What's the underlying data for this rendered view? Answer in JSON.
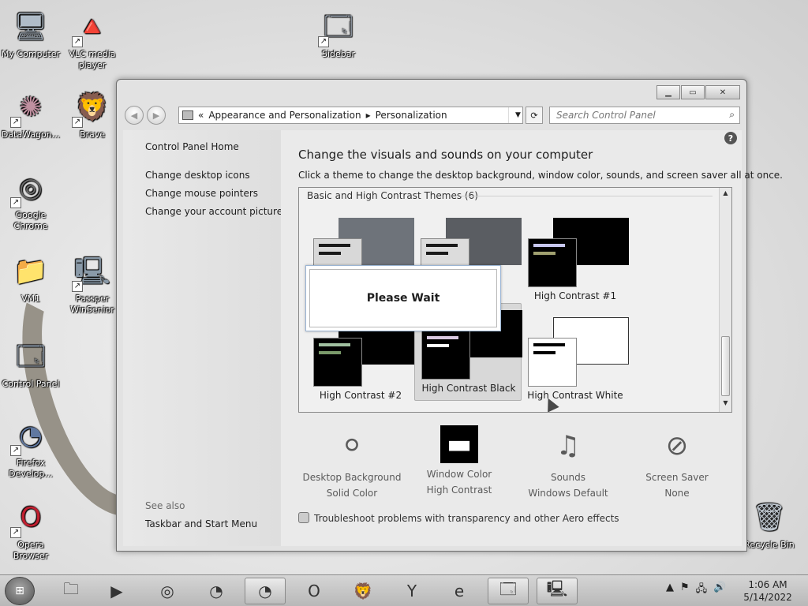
{
  "desktop": {
    "icons": [
      {
        "label": "My Computer",
        "name": "my-computer",
        "glyph": "🖥",
        "shortcut": false
      },
      {
        "label": "VLC media player",
        "name": "vlc",
        "glyph": "🔺",
        "shortcut": true
      },
      {
        "label": "Sidebar",
        "name": "sidebar",
        "glyph": "🗔",
        "shortcut": true
      },
      {
        "label": "DataWagon...",
        "name": "datawagon",
        "glyph": "✺",
        "shortcut": true
      },
      {
        "label": "Brave",
        "name": "brave",
        "glyph": "🦁",
        "shortcut": true
      },
      {
        "label": "Google Chrome",
        "name": "google-chrome",
        "glyph": "◎",
        "shortcut": true
      },
      {
        "label": "VM1",
        "name": "vm1",
        "glyph": "📁",
        "shortcut": false
      },
      {
        "label": "Passper WinSenior",
        "name": "passper-winsenior",
        "glyph": "🖳",
        "shortcut": true
      },
      {
        "label": "Control Panel",
        "name": "control-panel",
        "glyph": "🗔",
        "shortcut": false
      },
      {
        "label": "Firefox Develop...",
        "name": "firefox-developer",
        "glyph": "◔",
        "shortcut": true
      },
      {
        "label": "Opera Browser",
        "name": "opera",
        "glyph": "O",
        "shortcut": true
      },
      {
        "label": "Recycle Bin",
        "name": "recycle-bin",
        "glyph": "🗑",
        "shortcut": false
      }
    ]
  },
  "window": {
    "controls": {
      "minimize": "▁",
      "maximize": "▭",
      "close": "✕"
    },
    "nav": {
      "back": "◀",
      "forward": "▶"
    },
    "address": {
      "chevrons": "«",
      "separator": "▸",
      "crumb1": "Appearance and Personalization",
      "crumb2": "Personalization",
      "dropdown": "▼"
    },
    "refresh": "⟳",
    "search": {
      "placeholder": "Search Control Panel",
      "icon": "⌕"
    },
    "left": {
      "home": "Control Panel Home",
      "links": [
        "Change desktop icons",
        "Change mouse pointers",
        "Change your account picture"
      ],
      "see_also": "See also",
      "taskbar_link": "Taskbar and Start Menu"
    },
    "content": {
      "help": "?",
      "title": "Change the visuals and sounds on your computer",
      "description": "Click a theme to change the desktop background, window color, sounds, and screen saver all at once.",
      "group_header": "Basic and High Contrast Themes (6)",
      "themes": [
        {
          "label": "",
          "bg": "#6e737a",
          "win": "#d8d8d8",
          "bar1": "#1a1a1a",
          "bar2": "#1a1a1a"
        },
        {
          "label": "",
          "bg": "#5a5d62",
          "win": "#dcdcdc",
          "bar1": "#1a1a1a",
          "bar2": "#1a1a1a"
        },
        {
          "label": "High Contrast #1",
          "bg": "#000000",
          "win": "#000000",
          "bar1": "#c8c8f0",
          "bar2": "#a0a070"
        },
        {
          "label": "High Contrast #2",
          "bg": "#000000",
          "win": "#000000",
          "bar1": "#a0c0a0",
          "bar2": "#7a9a6a"
        },
        {
          "label": "High Contrast Black",
          "bg": "#000000",
          "win": "#000000",
          "bar1": "#d8c8e0",
          "bar2": "#ffffff"
        },
        {
          "label": "High Contrast White",
          "bg": "#ffffff",
          "win": "#ffffff",
          "bar1": "#000000",
          "bar2": "#000000"
        }
      ],
      "wait_text": "Please Wait",
      "bottom": [
        {
          "title": "Desktop Background",
          "value": "Solid Color",
          "icon": "⚪"
        },
        {
          "title": "Window Color",
          "value": "High Contrast",
          "icon": "▬"
        },
        {
          "title": "Sounds",
          "value": "Windows Default",
          "icon": "♫"
        },
        {
          "title": "Screen Saver",
          "value": "None",
          "icon": "⊘"
        }
      ],
      "troubleshoot": "Troubleshoot problems with transparency and other Aero effects"
    }
  },
  "taskbar": {
    "start": "⊞",
    "apps": [
      {
        "name": "file-explorer",
        "glyph": "🗀",
        "active": false
      },
      {
        "name": "media-player",
        "glyph": "▶",
        "active": false
      },
      {
        "name": "chrome",
        "glyph": "◎",
        "active": false
      },
      {
        "name": "firefox",
        "glyph": "◔",
        "active": false
      },
      {
        "name": "firefox-developer",
        "glyph": "◔",
        "active": true
      },
      {
        "name": "opera",
        "glyph": "O",
        "active": false
      },
      {
        "name": "brave",
        "glyph": "🦁",
        "active": false
      },
      {
        "name": "yandex",
        "glyph": "Y",
        "active": false
      },
      {
        "name": "internet-explorer",
        "glyph": "e",
        "active": false
      },
      {
        "name": "control-panel",
        "glyph": "🗔",
        "active": true
      },
      {
        "name": "passper",
        "glyph": "🖳",
        "active": true
      }
    ],
    "tray": {
      "show_hidden": "▲",
      "flag": "⚑",
      "network": "🖧",
      "volume": "🔊"
    },
    "time": "1:06 AM",
    "date": "5/14/2022"
  }
}
